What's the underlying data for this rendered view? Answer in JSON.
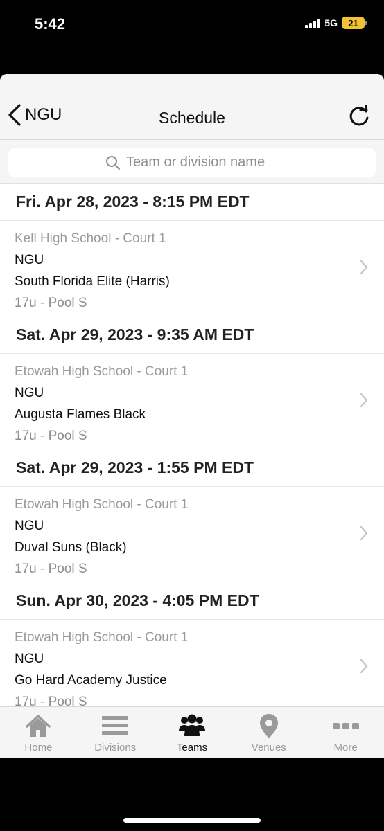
{
  "status": {
    "time": "5:42",
    "network": "5G",
    "battery": "21"
  },
  "nav": {
    "back_label": "NGU",
    "title": "Schedule"
  },
  "search": {
    "placeholder": "Team or division name"
  },
  "schedule": [
    {
      "datetime": "Fri. Apr 28, 2023 - 8:15 PM EDT",
      "venue": "Kell High School - Court 1",
      "team1": "NGU",
      "team2": "South Florida Elite (Harris)",
      "pool": "17u - Pool S"
    },
    {
      "datetime": "Sat. Apr 29, 2023 - 9:35 AM EDT",
      "venue": "Etowah High School - Court 1",
      "team1": "NGU",
      "team2": "Augusta Flames Black",
      "pool": "17u - Pool S"
    },
    {
      "datetime": "Sat. Apr 29, 2023 - 1:55 PM EDT",
      "venue": "Etowah High School - Court 1",
      "team1": "NGU",
      "team2": "Duval Suns (Black)",
      "pool": "17u - Pool S"
    },
    {
      "datetime": "Sun. Apr 30, 2023 - 4:05 PM EDT",
      "venue": "Etowah High School - Court 1",
      "team1": "NGU",
      "team2": "Go Hard Academy Justice",
      "pool": "17u - Pool S"
    }
  ],
  "tabs": [
    {
      "label": "Home",
      "icon": "home-icon",
      "active": false
    },
    {
      "label": "Divisions",
      "icon": "list-icon",
      "active": false
    },
    {
      "label": "Teams",
      "icon": "people-icon",
      "active": true
    },
    {
      "label": "Venues",
      "icon": "location-pin-icon",
      "active": false
    },
    {
      "label": "More",
      "icon": "more-dots-icon",
      "active": false
    }
  ],
  "colors": {
    "tab_inactive": "#9a9a9a",
    "tab_active": "#111111",
    "nav_bg": "#f5f5f5"
  }
}
